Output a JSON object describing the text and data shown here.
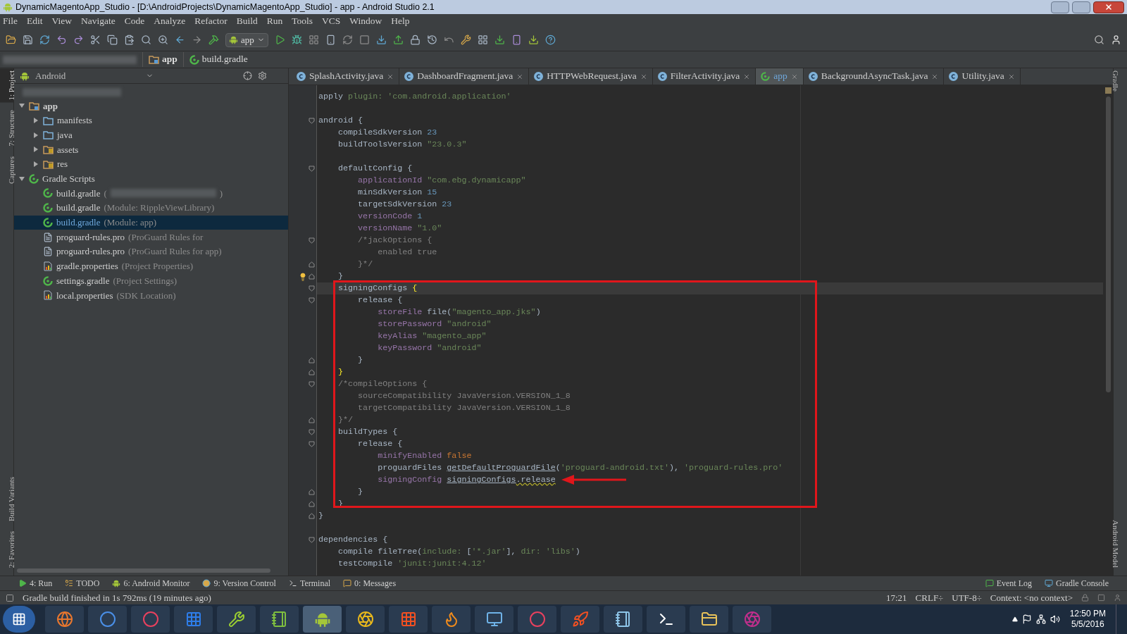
{
  "window": {
    "title": "DynamicMagentoApp_Studio - [D:\\AndroidProjects\\DynamicMagentoApp_Studio] - app - Android Studio 2.1"
  },
  "menu": [
    "File",
    "Edit",
    "View",
    "Navigate",
    "Code",
    "Analyze",
    "Refactor",
    "Build",
    "Run",
    "Tools",
    "VCS",
    "Window",
    "Help"
  ],
  "toolbar": {
    "run_config": "app"
  },
  "breadcrumb": [
    {
      "label": "app",
      "kind": "module"
    },
    {
      "label": "build.gradle",
      "kind": "gradle"
    }
  ],
  "left_strip_top": [
    {
      "label": "1: Project",
      "selected": true
    },
    {
      "label": "7: Structure",
      "selected": false
    },
    {
      "label": "Captures",
      "selected": false
    }
  ],
  "left_strip_bottom": [
    {
      "label": "Build Variants",
      "selected": false
    },
    {
      "label": "2: Favorites",
      "selected": false
    }
  ],
  "right_strip_top": [
    "Gradle"
  ],
  "right_strip_bottom": [
    "Android Model"
  ],
  "project": {
    "view": "Android",
    "tree": [
      {
        "label": "app",
        "kind": "module",
        "expanded": true,
        "selected": false,
        "children": [
          {
            "label": "manifests",
            "kind": "folder",
            "expanded": false,
            "selected": false
          },
          {
            "label": "java",
            "kind": "folder",
            "expanded": false,
            "selected": false
          },
          {
            "label": "assets",
            "kind": "resfolder",
            "expanded": false,
            "selected": false
          },
          {
            "label": "res",
            "kind": "resfolder",
            "expanded": false,
            "selected": false
          }
        ]
      },
      {
        "label": "Gradle Scripts",
        "kind": "gradle",
        "expanded": true,
        "selected": false,
        "children": [
          {
            "label": "build.gradle",
            "hint": "(",
            "hint_end": ")",
            "kind": "gradle",
            "selected": false
          },
          {
            "label": "build.gradle",
            "hint": "(Module: RippleViewLibrary)",
            "kind": "gradle",
            "selected": false
          },
          {
            "label": "build.gradle",
            "hint": "(Module: app)",
            "kind": "gradle",
            "selected": true
          },
          {
            "label": "proguard-rules.pro",
            "hint": "(ProGuard Rules for",
            "kind": "file",
            "selected": false
          },
          {
            "label": "proguard-rules.pro",
            "hint": "(ProGuard Rules for app)",
            "kind": "file",
            "selected": false
          },
          {
            "label": "gradle.properties",
            "hint": "(Project Properties)",
            "kind": "props",
            "selected": false
          },
          {
            "label": "settings.gradle",
            "hint": "(Project Settings)",
            "kind": "gradle",
            "selected": false
          },
          {
            "label": "local.properties",
            "hint": "(SDK Location)",
            "kind": "props",
            "selected": false
          }
        ]
      }
    ]
  },
  "tabs": [
    {
      "label": "SplashActivity.java",
      "kind": "class",
      "selected": false
    },
    {
      "label": "DashboardFragment.java",
      "kind": "class",
      "selected": false
    },
    {
      "label": "HTTPWebRequest.java",
      "kind": "class",
      "selected": false
    },
    {
      "label": "FilterActivity.java",
      "kind": "class",
      "selected": false
    },
    {
      "label": "app",
      "kind": "gradle",
      "selected": true
    },
    {
      "label": "BackgroundAsyncTask.java",
      "kind": "class",
      "selected": false
    },
    {
      "label": "Utility.java",
      "kind": "class",
      "selected": false
    }
  ],
  "code": [
    {
      "current": false,
      "kind": "line",
      "tokens": [
        {
          "text": "apply ",
          "kind": "plain"
        },
        {
          "text": "plugin: ",
          "kind": "named"
        },
        {
          "text": "'com.android.application'",
          "kind": "string"
        }
      ]
    },
    {
      "current": false,
      "kind": "line"
    },
    {
      "current": false,
      "kind": "fold_start",
      "tokens": [
        {
          "text": "android {",
          "kind": "plain"
        }
      ]
    },
    {
      "current": false,
      "kind": "line",
      "tokens": [
        {
          "text": "    compileSdkVersion ",
          "kind": "plain"
        },
        {
          "text": "23",
          "kind": "number"
        }
      ]
    },
    {
      "current": false,
      "kind": "line",
      "tokens": [
        {
          "text": "    buildToolsVersion ",
          "kind": "plain"
        },
        {
          "text": "\"23.0.3\"",
          "kind": "string"
        }
      ]
    },
    {
      "current": false,
      "kind": "line"
    },
    {
      "current": false,
      "kind": "fold_start",
      "tokens": [
        {
          "text": "    defaultConfig {",
          "kind": "plain"
        }
      ]
    },
    {
      "current": false,
      "kind": "line",
      "tokens": [
        {
          "text": "        applicationId ",
          "kind": "property"
        },
        {
          "text": "\"com.ebg.dynamicapp\"",
          "kind": "string"
        }
      ]
    },
    {
      "current": false,
      "kind": "line",
      "tokens": [
        {
          "text": "        minSdkVersion ",
          "kind": "plain"
        },
        {
          "text": "15",
          "kind": "number"
        }
      ]
    },
    {
      "current": false,
      "kind": "line",
      "tokens": [
        {
          "text": "        targetSdkVersion ",
          "kind": "plain"
        },
        {
          "text": "23",
          "kind": "number"
        }
      ]
    },
    {
      "current": false,
      "kind": "line",
      "tokens": [
        {
          "text": "        versionCode ",
          "kind": "property"
        },
        {
          "text": "1",
          "kind": "number"
        }
      ]
    },
    {
      "current": false,
      "kind": "line",
      "tokens": [
        {
          "text": "        versionName ",
          "kind": "property"
        },
        {
          "text": "\"1.0\"",
          "kind": "string"
        }
      ]
    },
    {
      "current": false,
      "kind": "fold_start",
      "tokens": [
        {
          "text": "        /*jackOptions {",
          "kind": "comment"
        }
      ]
    },
    {
      "current": false,
      "kind": "line",
      "tokens": [
        {
          "text": "            enabled true",
          "kind": "comment"
        }
      ]
    },
    {
      "current": false,
      "kind": "fold_end",
      "tokens": [
        {
          "text": "        }*/",
          "kind": "comment"
        }
      ]
    },
    {
      "current": false,
      "kind": "fold_end_bulb",
      "tokens": [
        {
          "text": "    }",
          "kind": "plain"
        }
      ]
    },
    {
      "current": true,
      "kind": "fold_start",
      "tokens": [
        {
          "text": "    signingConfigs ",
          "kind": "plain"
        },
        {
          "text": "{",
          "kind": "brace"
        }
      ]
    },
    {
      "current": false,
      "kind": "fold_start",
      "tokens": [
        {
          "text": "        release {",
          "kind": "plain"
        }
      ]
    },
    {
      "current": false,
      "kind": "line",
      "tokens": [
        {
          "text": "            storeFile ",
          "kind": "property"
        },
        {
          "text": "file(",
          "kind": "plain"
        },
        {
          "text": "\"magento_app.jks\"",
          "kind": "string"
        },
        {
          "text": ")",
          "kind": "plain"
        }
      ]
    },
    {
      "current": false,
      "kind": "line",
      "tokens": [
        {
          "text": "            storePassword ",
          "kind": "property"
        },
        {
          "text": "\"android\"",
          "kind": "string"
        }
      ]
    },
    {
      "current": false,
      "kind": "line",
      "tokens": [
        {
          "text": "            keyAlias ",
          "kind": "property"
        },
        {
          "text": "\"magento_app\"",
          "kind": "string"
        }
      ]
    },
    {
      "current": false,
      "kind": "line",
      "tokens": [
        {
          "text": "            keyPassword ",
          "kind": "property"
        },
        {
          "text": "\"android\"",
          "kind": "string"
        }
      ]
    },
    {
      "current": false,
      "kind": "fold_end",
      "tokens": [
        {
          "text": "        }",
          "kind": "plain"
        }
      ]
    },
    {
      "current": false,
      "kind": "fold_end",
      "tokens": [
        {
          "text": "    }",
          "kind": "brace"
        }
      ]
    },
    {
      "current": false,
      "kind": "fold_start",
      "tokens": [
        {
          "text": "    /*compileOptions {",
          "kind": "comment"
        }
      ]
    },
    {
      "current": false,
      "kind": "line",
      "tokens": [
        {
          "text": "        sourceCompatibility JavaVersion.VERSION_1_8",
          "kind": "comment"
        }
      ]
    },
    {
      "current": false,
      "kind": "line",
      "tokens": [
        {
          "text": "        targetCompatibility JavaVersion.VERSION_1_8",
          "kind": "comment"
        }
      ]
    },
    {
      "current": false,
      "kind": "fold_end",
      "tokens": [
        {
          "text": "    }*/",
          "kind": "comment"
        }
      ]
    },
    {
      "current": false,
      "kind": "fold_start",
      "tokens": [
        {
          "text": "    buildTypes {",
          "kind": "plain"
        }
      ]
    },
    {
      "current": false,
      "kind": "fold_start",
      "tokens": [
        {
          "text": "        release {",
          "kind": "plain"
        }
      ]
    },
    {
      "current": false,
      "kind": "line",
      "tokens": [
        {
          "text": "            minifyEnabled ",
          "kind": "property"
        },
        {
          "text": "false",
          "kind": "keyword"
        }
      ]
    },
    {
      "current": false,
      "kind": "line",
      "tokens": [
        {
          "text": "            proguardFiles ",
          "kind": "plain"
        },
        {
          "text": "getDefaultProguardFile",
          "kind": "link"
        },
        {
          "text": "(",
          "kind": "plain"
        },
        {
          "text": "'proguard-android.txt'",
          "kind": "string"
        },
        {
          "text": "), ",
          "kind": "plain"
        },
        {
          "text": "'proguard-rules.pro'",
          "kind": "string"
        }
      ]
    },
    {
      "current": false,
      "kind": "line",
      "tokens": [
        {
          "text": "            signingConfig ",
          "kind": "property"
        },
        {
          "text": "signingConfigs",
          "kind": "link"
        },
        {
          "text": ".release",
          "kind": "warn"
        }
      ]
    },
    {
      "current": false,
      "kind": "fold_end",
      "tokens": [
        {
          "text": "        }",
          "kind": "plain"
        }
      ]
    },
    {
      "current": false,
      "kind": "fold_end",
      "tokens": [
        {
          "text": "    }",
          "kind": "plain"
        }
      ]
    },
    {
      "current": false,
      "kind": "fold_end",
      "tokens": [
        {
          "text": "}",
          "kind": "plain"
        }
      ]
    },
    {
      "current": false,
      "kind": "line"
    },
    {
      "current": false,
      "kind": "fold_start",
      "tokens": [
        {
          "text": "dependencies {",
          "kind": "plain"
        }
      ]
    },
    {
      "current": false,
      "kind": "line",
      "tokens": [
        {
          "text": "    compile fileTree(",
          "kind": "plain"
        },
        {
          "text": "include: ",
          "kind": "named"
        },
        {
          "text": "[",
          "kind": "plain"
        },
        {
          "text": "'*.jar'",
          "kind": "string"
        },
        {
          "text": "], ",
          "kind": "plain"
        },
        {
          "text": "dir: ",
          "kind": "named"
        },
        {
          "text": "'libs'",
          "kind": "string"
        },
        {
          "text": ")",
          "kind": "plain"
        }
      ]
    },
    {
      "current": false,
      "kind": "line",
      "tokens": [
        {
          "text": "    testCompile ",
          "kind": "plain"
        },
        {
          "text": "'junit:junit:4.12'",
          "kind": "string"
        }
      ]
    }
  ],
  "tool_windows_left": [
    {
      "label": "4: Run",
      "kind": "run"
    },
    {
      "label": "TODO",
      "kind": "todo"
    },
    {
      "label": "6: Android Monitor",
      "kind": "android"
    },
    {
      "label": "9: Version Control",
      "kind": "vcs"
    },
    {
      "label": "Terminal",
      "kind": "terminal"
    },
    {
      "label": "0: Messages",
      "kind": "messages"
    }
  ],
  "tool_windows_right": [
    {
      "label": "Event Log",
      "kind": "log"
    },
    {
      "label": "Gradle Console",
      "kind": "console"
    }
  ],
  "status": {
    "message": "Gradle build finished in 1s 792ms (19 minutes ago)",
    "position": "17:21",
    "line_sep": "CRLF÷",
    "encoding": "UTF-8÷",
    "context": "Context: <no context>"
  },
  "clock": {
    "time": "12:50 PM",
    "date": "5/5/2016"
  }
}
